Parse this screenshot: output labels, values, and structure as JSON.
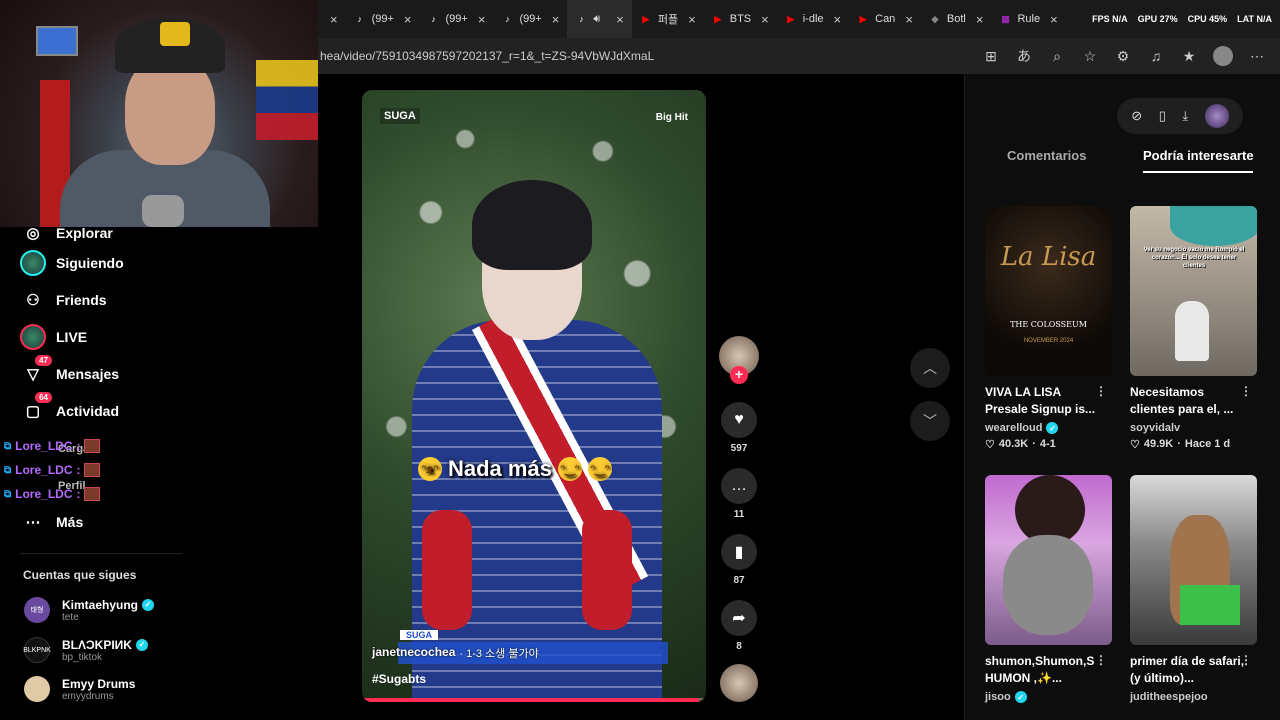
{
  "browser": {
    "tabs": [
      {
        "label": "",
        "icon": "close-icon",
        "color": "#ffffff"
      },
      {
        "label": "(99+",
        "icon": "tiktok-icon",
        "color": "#ffffff"
      },
      {
        "label": "(99+",
        "icon": "tiktok-icon",
        "color": "#ffffff"
      },
      {
        "label": "(99+",
        "icon": "tiktok-icon",
        "color": "#ffffff"
      },
      {
        "label": "",
        "icon": "tiktok-icon",
        "color": "#ffffff",
        "active": true
      },
      {
        "label": "퍼플",
        "icon": "youtube-icon",
        "color": "#ff0000"
      },
      {
        "label": "BTS",
        "icon": "youtube-icon",
        "color": "#ff0000"
      },
      {
        "label": "i-dle",
        "icon": "youtube-icon",
        "color": "#ff0000"
      },
      {
        "label": "Can",
        "icon": "youtube-icon",
        "color": "#ff0000"
      },
      {
        "label": "Botl",
        "icon": "shield-icon",
        "color": "#888888"
      },
      {
        "label": "Rule",
        "icon": "grid-icon",
        "color": "#9c27b0"
      }
    ],
    "stats": {
      "fps": "FPS N/A",
      "gpu": "GPU 27%",
      "cpu": "CPU 45%",
      "lat": "LAT N/A"
    },
    "url": "hea/video/7591034987597202137_r=1&_t=ZS-94VbWJdXmaL"
  },
  "sidebar": {
    "nav": [
      {
        "label": "Explorar",
        "icon": "compass-icon"
      },
      {
        "label": "Siguiendo",
        "icon": "following-icon"
      },
      {
        "label": "Friends",
        "icon": "friends-icon"
      },
      {
        "label": "LIVE",
        "icon": "live-icon"
      },
      {
        "label": "Mensajes",
        "icon": "messages-icon",
        "badge": "47"
      },
      {
        "label": "Actividad",
        "icon": "activity-icon",
        "badge": "64"
      }
    ],
    "chat": [
      {
        "user": "Lore_LDC",
        "sep": ":"
      },
      {
        "user": "Lore_LDC",
        "sep": ":"
      },
      {
        "user": "Lore_LDC",
        "sep": ":"
      }
    ],
    "overlap_labels": {
      "cargar": "Cargar",
      "perfil": "Perfil"
    },
    "more_label": "Más",
    "following_title": "Cuentas que sigues",
    "accounts": [
      {
        "name": "Kimtaehyung",
        "handle": "tete",
        "verified": true,
        "pic_text": "태형",
        "color": "#6a4aa0"
      },
      {
        "name": "BLΛƆKPIИK",
        "handle": "bp_tiktok",
        "verified": true,
        "pic_text": "BLKPNK",
        "color": "#111111"
      },
      {
        "name": "Emyy Drums",
        "handle": "emyydrums",
        "verified": false,
        "pic_text": "",
        "color": "#e0c9a6"
      }
    ]
  },
  "video": {
    "top_left_logo": "SUGA",
    "top_right_logo": "Big Hit",
    "caption": "Nada más",
    "lower_tag": "SUGA",
    "author": "janetnecochea",
    "subtitle": "· 1-3 소생 불가야",
    "hashtag": "#Sugabts",
    "progress": 0.98
  },
  "actions": {
    "likes": "597",
    "comments": "11",
    "saves": "87",
    "shares": "8"
  },
  "right_panel": {
    "tabs": {
      "comments": "Comentarios",
      "suggested": "Podría interesarte"
    },
    "cards": [
      {
        "title": "VIVA LA LISA Presale Signup is...",
        "user": "wearelloud",
        "verified": true,
        "stats": [
          "40.3K",
          "4-1"
        ],
        "thumb_main": "La Lisa",
        "thumb_sub": "THE COLOSSEUM",
        "thumb_date": "NOVEMBER 2024"
      },
      {
        "title": "Necesitamos clientes para el, ...",
        "user": "soyvidalv",
        "verified": false,
        "stats": [
          "49.9K",
          "Hace 1 d"
        ],
        "thumb_caption": "Ver su negocio vacío me Rompió el corazón... Él solo desea tener clientes"
      },
      {
        "title": "shumon,Shumon,S HUMON ,✨...",
        "user": "jisoo",
        "verified": true
      },
      {
        "title": "primer día de safari, (y último)...",
        "user": "juditheespejoo",
        "verified": false
      }
    ]
  }
}
